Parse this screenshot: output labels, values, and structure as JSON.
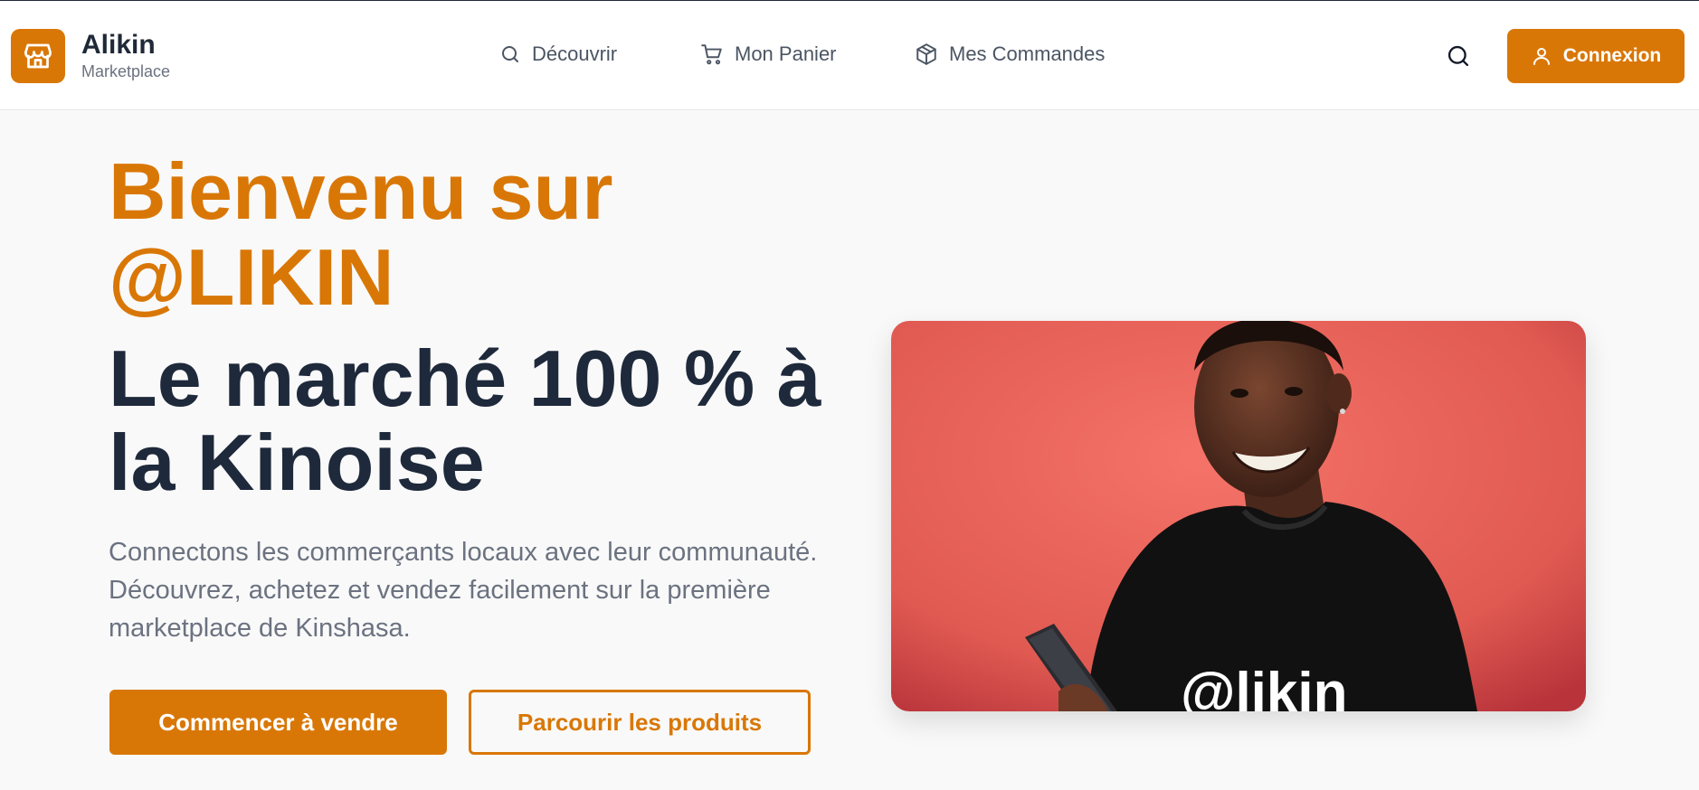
{
  "brand": {
    "name": "Alikin",
    "subtitle": "Marketplace",
    "accent": "#d97706"
  },
  "nav": {
    "items": [
      {
        "label": "Découvrir",
        "icon": "search-icon"
      },
      {
        "label": "Mon Panier",
        "icon": "cart-icon"
      },
      {
        "label": "Mes Commandes",
        "icon": "package-icon"
      }
    ]
  },
  "header": {
    "search_icon": "search-icon",
    "login_label": "Connexion",
    "login_icon": "user-icon"
  },
  "hero": {
    "title_line1": "Bienvenu sur @LIKIN",
    "title_line2": "Le marché 100 % à la Kinoise",
    "description": "Connectons les commerçants locaux avec leur communauté. Découvrez, achetez et vendez facilement sur la première marketplace de Kinshasa.",
    "primary_button": "Commencer à vendre",
    "secondary_button": "Parcourir les produits",
    "image_shirt_text": "@likin",
    "image_bg_color": "#e85c55"
  }
}
